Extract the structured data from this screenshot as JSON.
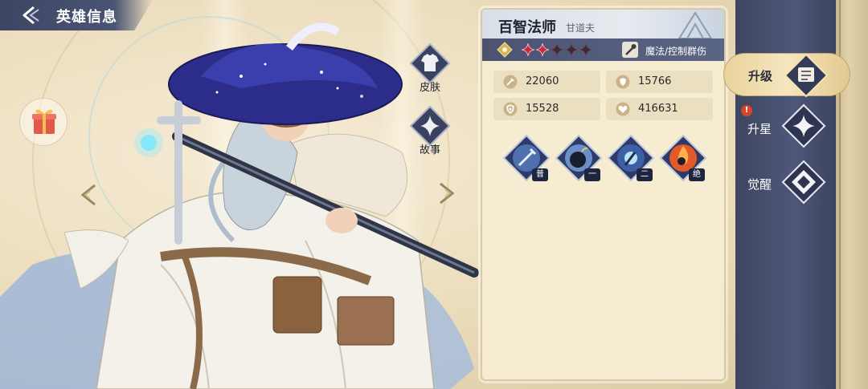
{
  "header": {
    "title": "英雄信息"
  },
  "side_buttons": {
    "skin": "皮肤",
    "story": "故事"
  },
  "hero": {
    "name": "百智法师",
    "sub_name": "甘道夫",
    "stars_filled": 2,
    "stars_total": 5,
    "role": "魔法/控制群伤"
  },
  "stats": [
    {
      "icon": "sword-icon",
      "value": "22060"
    },
    {
      "icon": "shield-icon",
      "value": "15766"
    },
    {
      "icon": "magic-shield-icon",
      "value": "15528"
    },
    {
      "icon": "heart-icon",
      "value": "416631"
    }
  ],
  "skills": [
    {
      "icon": "sword-skill-icon",
      "tag": "普"
    },
    {
      "icon": "bomb-skill-icon",
      "tag": "一"
    },
    {
      "icon": "light-skill-icon",
      "tag": "二"
    },
    {
      "icon": "fire-skill-icon",
      "tag": "绝"
    }
  ],
  "right_nav": {
    "upgrade": "升级",
    "star_up": "升星",
    "awaken": "觉醒",
    "star_up_badge": "!"
  },
  "colors": {
    "panel_bg": "#f6ecd2",
    "nav_bg": "#4b5473",
    "active_tab": "#f0dcaa",
    "star_red": "#c9293f"
  }
}
